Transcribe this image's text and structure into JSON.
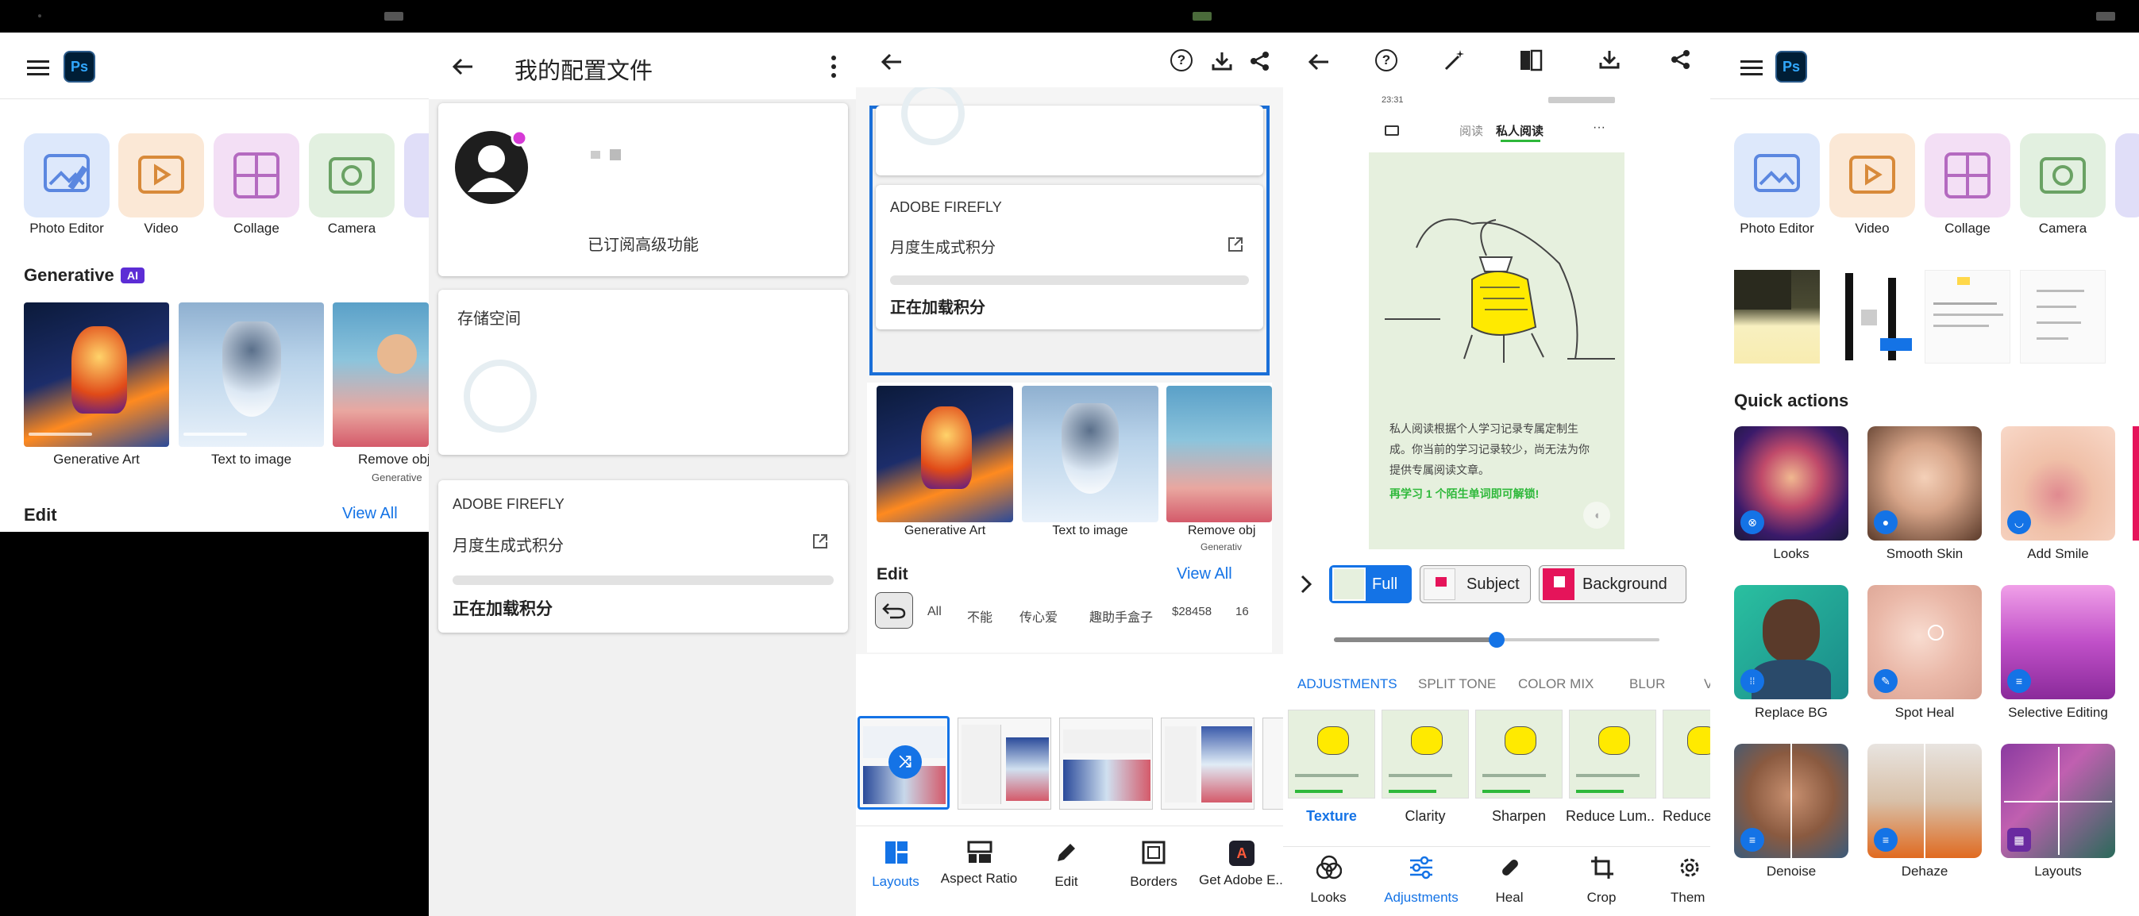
{
  "pane1": {
    "apps": [
      "Photo Editor",
      "Video",
      "Collage",
      "Camera"
    ],
    "generative_title": "Generative",
    "ai_badge": "AI",
    "gen_items": [
      "Generative Art",
      "Text to image",
      "Remove obj",
      "Generative"
    ],
    "edit_title": "Edit",
    "view_all": "View All",
    "ps_label": "Ps"
  },
  "pane2": {
    "title": "我的配置文件",
    "subscribed": "已订阅高级功能",
    "storage": "存储空间",
    "firefly": "ADOBE FIREFLY",
    "monthly_credits": "月度生成式积分",
    "loading": "正在加载积分"
  },
  "pane3": {
    "firefly": "ADOBE FIREFLY",
    "monthly_credits": "月度生成式积分",
    "loading": "正在加载积分",
    "gen_items": [
      "Generative Art",
      "Text to image",
      "Remove obj",
      "Generativ"
    ],
    "edit_title": "Edit",
    "view_all": "View All",
    "chips": [
      "ll",
      "All",
      "不能",
      "传心爱",
      "趣助手盒子",
      "$28458",
      "16"
    ],
    "toolbar": [
      "Layouts",
      "Aspect Ratio",
      "Edit",
      "Borders",
      "Get Adobe E.."
    ]
  },
  "pane4": {
    "status_time": "23:31",
    "tab_read": "阅读",
    "tab_private": "私人阅读",
    "more": "···",
    "para1": "私人阅读根据个人学习记录专属定制生",
    "para2": "成。你当前的学习记录较少，尚无法为你",
    "para3": "提供专属阅读文章。",
    "unlock": "再学习 1 个陌生单词即可解锁!",
    "segments": [
      "Full",
      "Subject",
      "Background"
    ],
    "slider_value": 0.5,
    "categories": [
      "ADJUSTMENTS",
      "SPLIT TONE",
      "COLOR MIX",
      "BLUR",
      "V"
    ],
    "presets": [
      "Texture",
      "Clarity",
      "Sharpen",
      "Reduce Lum..",
      "Reduce"
    ],
    "toolbar": [
      "Looks",
      "Adjustments",
      "Heal",
      "Crop",
      "Them"
    ]
  },
  "pane5": {
    "apps": [
      "Photo Editor",
      "Video",
      "Collage",
      "Camera"
    ],
    "quick_actions": "Quick actions",
    "actions": [
      "Looks",
      "Smooth Skin",
      "Add Smile",
      "Replace BG",
      "Spot Heal",
      "Selective Editing",
      "Denoise",
      "Dehaze",
      "Layouts"
    ],
    "ps_label": "Ps"
  },
  "colors": {
    "accent": "#1473e6",
    "ai_badge": "#5c2dd5",
    "green_text": "#2eb83a",
    "pink": "#e5145a"
  }
}
